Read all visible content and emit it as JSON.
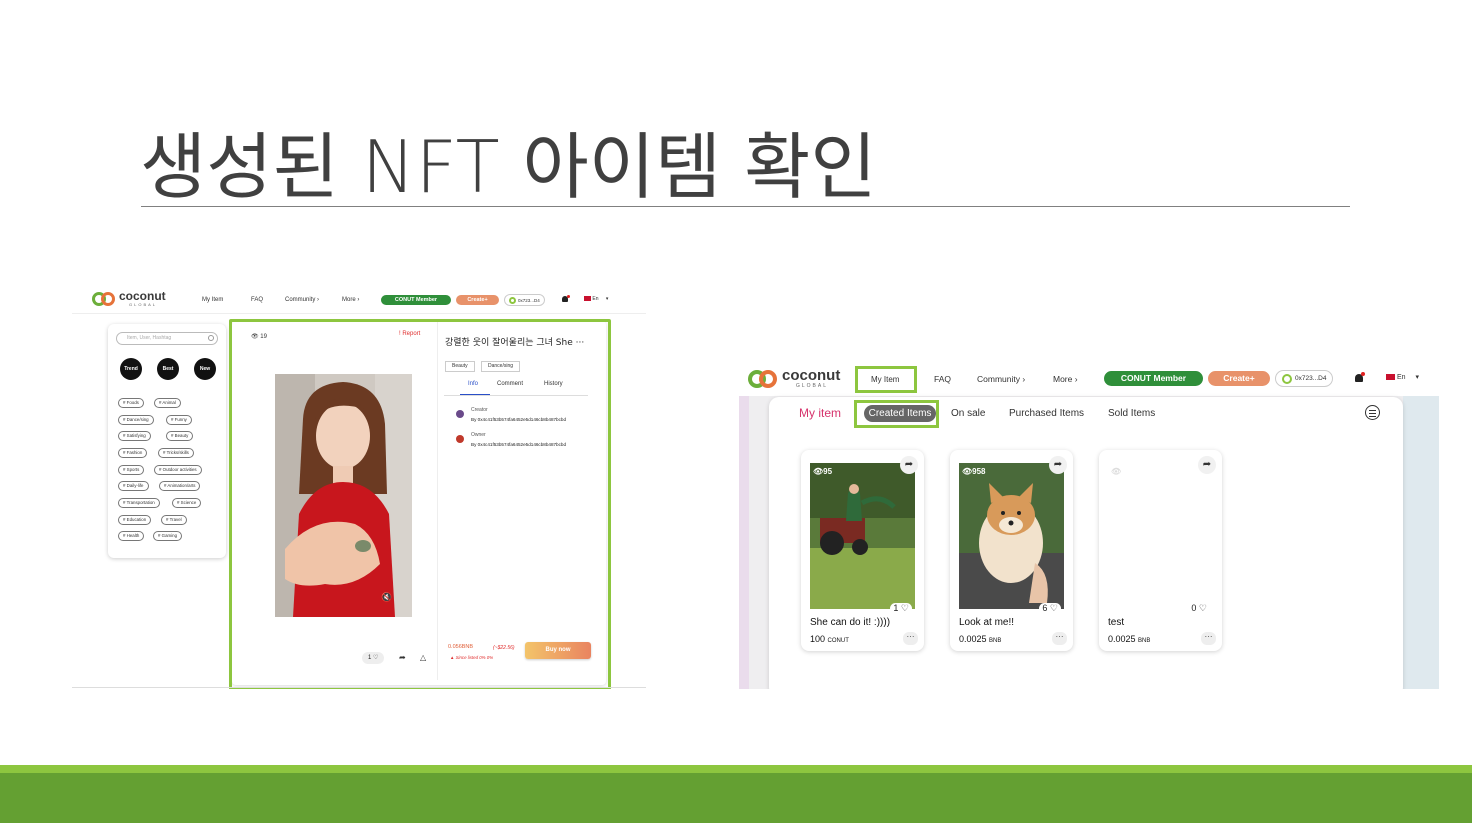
{
  "slide": {
    "title": "생성된 NFT 아이템 확인"
  },
  "colors": {
    "highlight": "#8dc63f",
    "footer": "#64a032",
    "member_pill": "#2f8f3a",
    "create_pill": "#e8926a",
    "my_item_accent": "#d6336c"
  },
  "left_screenshot": {
    "nav": {
      "logo_text": "coconut",
      "logo_sub": "GLOBAL",
      "links": [
        "My Item",
        "FAQ",
        "Community ›",
        "More ›"
      ],
      "member_button": "CONUT Member",
      "create_button": "Create+",
      "wallet": "0x723...D4",
      "language": "En"
    },
    "sidebar": {
      "search_placeholder": "Item, User, Hashtag",
      "filters": [
        "Trend",
        "Best",
        "New"
      ],
      "tags": [
        "# Foods",
        "# Animal",
        "# Dance/sing",
        "# Funny",
        "# Satisfying",
        "# Beauty",
        "# Fashion",
        "# Tricks/skills",
        "# Sports",
        "# Outdoor activities",
        "# Daily-life",
        "# Animation/arts",
        "# Transportation",
        "# Science",
        "# Education",
        "# Travel",
        "# Health",
        "# Gaming"
      ]
    },
    "detail": {
      "views": "19",
      "report": "! Report",
      "title": "강렬한 웃이 잘어울리는 그녀 She ···",
      "categories": [
        "Beauty",
        "Dance/sing"
      ],
      "tabs": [
        "Info",
        "Comment",
        "History"
      ],
      "creator_label": "Creator",
      "creator_addr": "By 0x4c41f53b574fa6452e5d146cb8b487bcbd",
      "owner_label": "Owner",
      "owner_addr": "By 0x4c41f53b574fa6452e5d146cb8b487bcbd",
      "price": "0.056BNB",
      "usd": "(~$22.56)",
      "since": "▲ Since listed 0% 0%",
      "buy_button": "Buy now",
      "likes": "1 ♡"
    }
  },
  "right_screenshot": {
    "nav": {
      "logo_text": "coconut",
      "logo_sub": "GLOBAL",
      "links": [
        "My Item",
        "FAQ",
        "Community ›",
        "More ›"
      ],
      "member_button": "CONUT Member",
      "create_button": "Create+",
      "wallet": "0x723...D4",
      "language": "En"
    },
    "page_title": "My item",
    "tabs": [
      "Created Items",
      "On sale",
      "Purchased Items",
      "Sold Items"
    ],
    "items": [
      {
        "views": "95",
        "likes": "1 ♡",
        "name": "She can do it! :))))",
        "price": "100",
        "unit": "CONUT"
      },
      {
        "views": "958",
        "likes": "6 ♡",
        "name": "Look at me!!",
        "price": "0.0025",
        "unit": "BNB"
      },
      {
        "views": "",
        "likes": "0 ♡",
        "name": "test",
        "price": "0.0025",
        "unit": "BNB"
      }
    ]
  }
}
